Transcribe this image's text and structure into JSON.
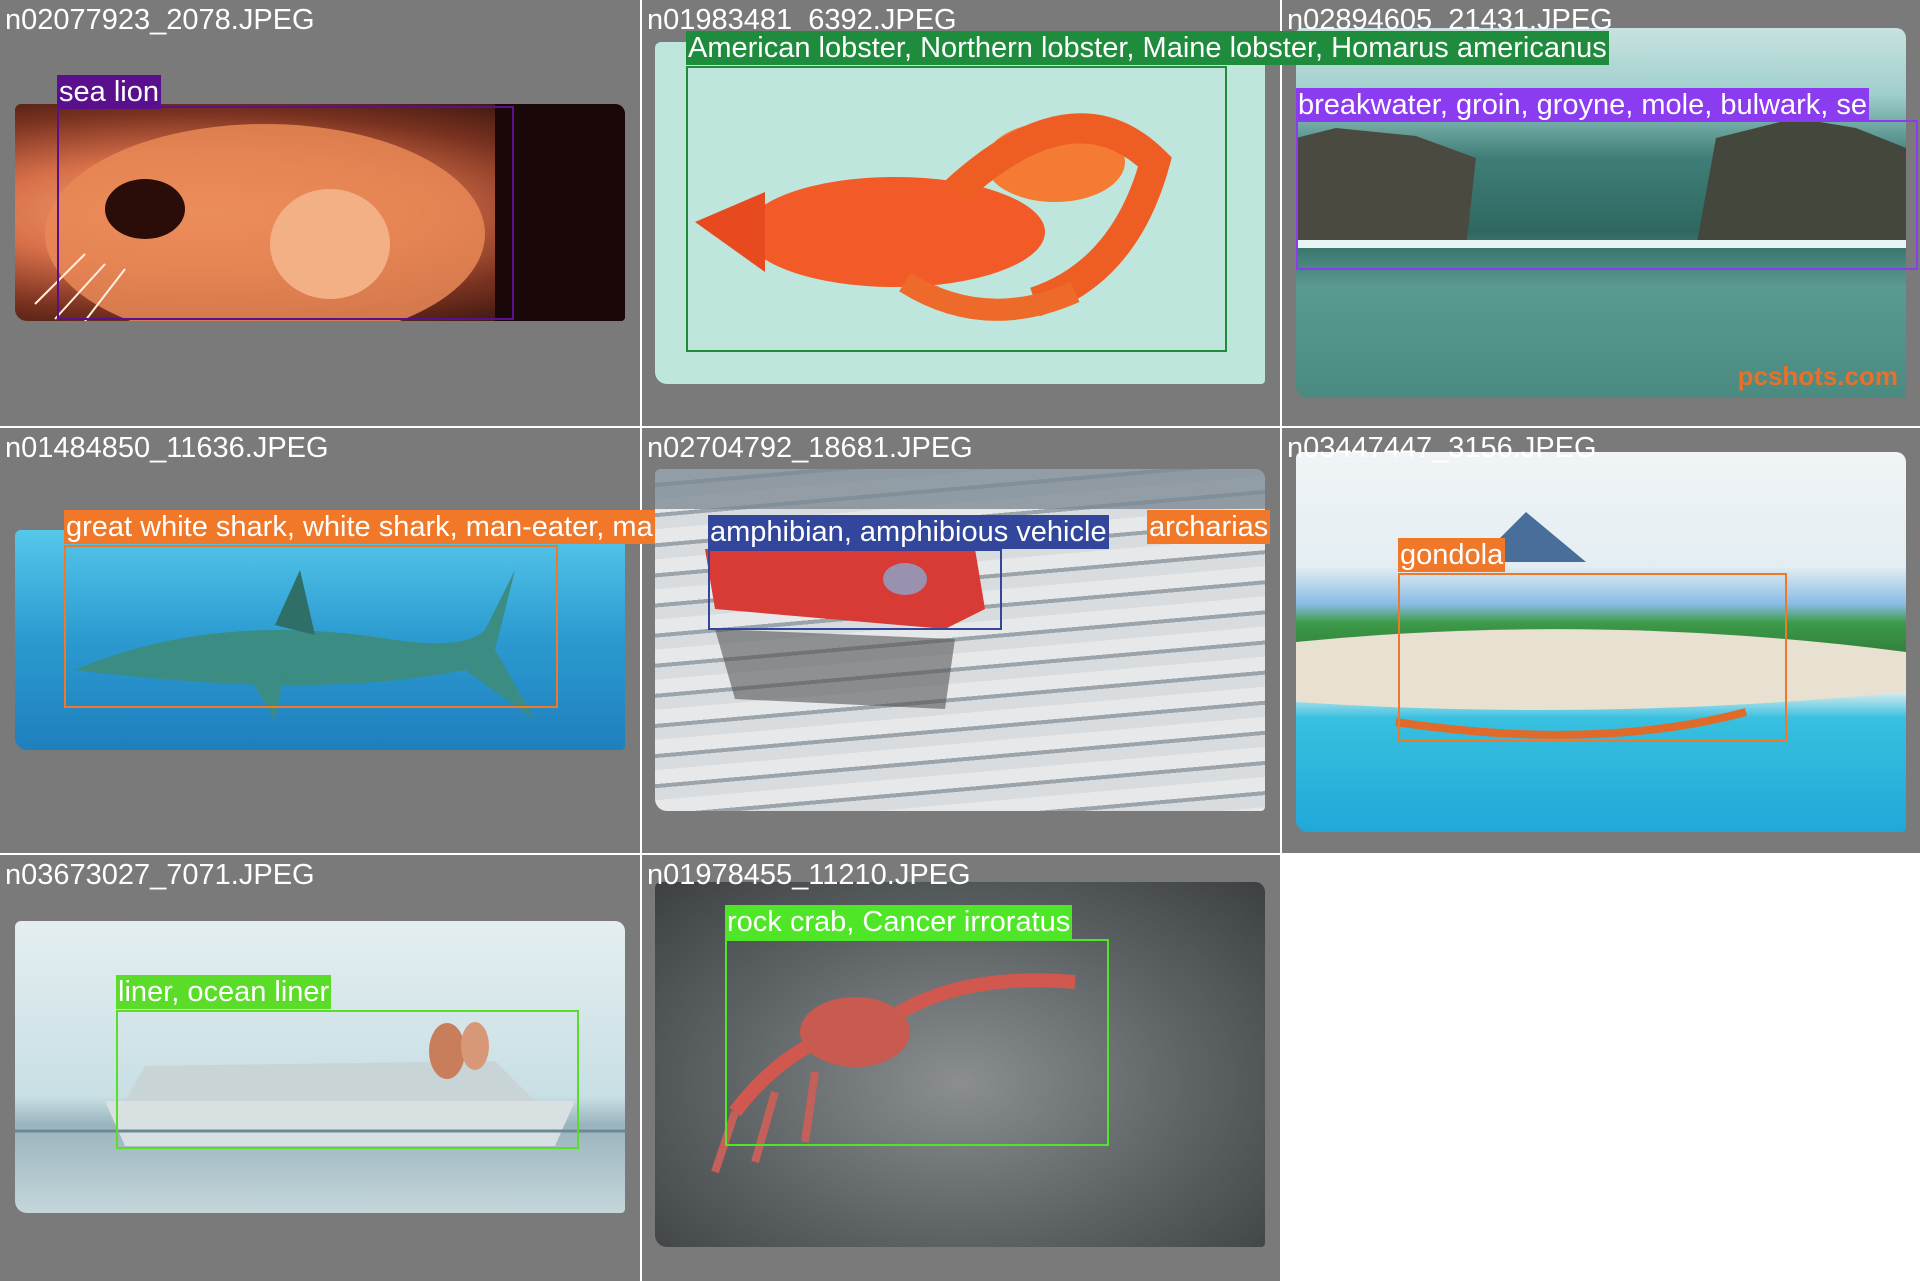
{
  "grid_title": "",
  "cells": [
    {
      "filename": "n02077923_2078.JPEG",
      "label": "sea lion",
      "color": "#5a0f8c"
    },
    {
      "filename": "n01983481_6392.JPEG",
      "label": "American lobster, Northern lobster, Maine lobster, Homarus americanus",
      "color": "#1e8c3c"
    },
    {
      "filename": "n02894605_21431.JPEG",
      "label": "breakwater, groin, groyne, mole, bulwark, se",
      "color": "#8c3cf0",
      "watermark": "pcshots.com"
    },
    {
      "filename": "n01484850_11636.JPEG",
      "label": "great white shark, white shark, man-eater, ma",
      "label_tail": "archarias",
      "color": "#f07828"
    },
    {
      "filename": "n02704792_18681.JPEG",
      "label": "amphibian, amphibious vehicle",
      "color": "#32469b"
    },
    {
      "filename": "n03447447_3156.JPEG",
      "label": "gondola",
      "color": "#f07828"
    },
    {
      "filename": "n03673027_7071.JPEG",
      "label": "liner, ocean liner",
      "color": "#5adc28"
    },
    {
      "filename": "n01978455_11210.JPEG",
      "label": "rock crab, Cancer irroratus",
      "color": "#50e628"
    }
  ]
}
